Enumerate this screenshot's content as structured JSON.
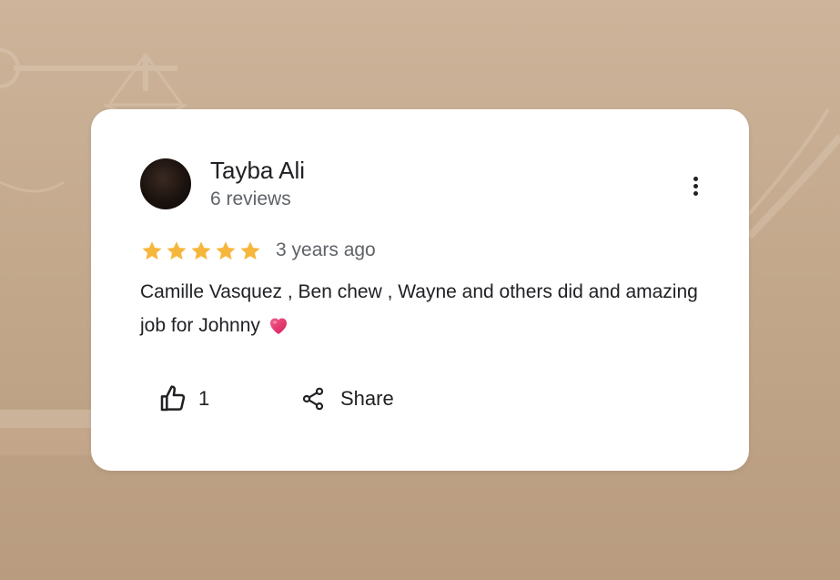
{
  "review": {
    "author": "Tayba Ali",
    "review_count": "6 reviews",
    "rating": 5,
    "time": "3 years ago",
    "text": "Camille Vasquez , Ben chew , Wayne and others did and amazing job for Johnny",
    "text_emoji": "heart-emoji"
  },
  "actions": {
    "like_count": "1",
    "share_label": "Share",
    "more_icon": "more-vert-icon",
    "like_icon": "thumb-up-icon",
    "share_icon": "share-icon"
  },
  "colors": {
    "star": "#f6b63c",
    "heart": "#e8336d",
    "background": "#c3a88c"
  }
}
